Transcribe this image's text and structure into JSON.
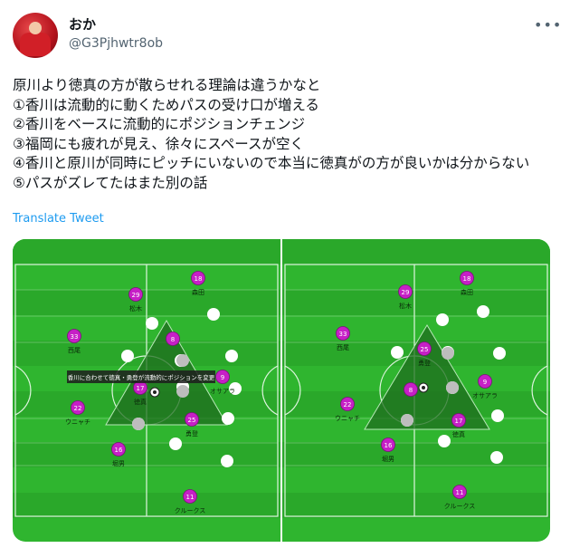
{
  "user": {
    "name": "おか",
    "handle": "@G3Pjhwtr8ob"
  },
  "icons": {
    "more": "more-horizontal-icon",
    "avatar": "profile-avatar"
  },
  "tweet": {
    "lines": [
      "原川より徳真の方が散らせれる理論は違うかなと",
      "①香川は流動的に動くためパスの受け口が増える",
      "②香川をベースに流動的にポジションチェンジ",
      "③福岡にも疲れが見え、徐々にスペースが空く",
      "④香川と原川が同時にピッチにいないので本当に徳真がの方が良いかは分からない",
      "⑤パスがズレてたはまた別の話"
    ],
    "translate": "Translate Tweet"
  },
  "left_pitch": {
    "annotation": "香川に合わせて徳真・勇登が流動的にポジションを変更",
    "players": [
      {
        "num": "18",
        "name": "森田"
      },
      {
        "num": "29",
        "name": "松木"
      },
      {
        "num": "33",
        "name": "西尾"
      },
      {
        "num": "8",
        "name": ""
      },
      {
        "num": "9",
        "name": "オサアラ"
      },
      {
        "num": "17",
        "name": "徳真"
      },
      {
        "num": "22",
        "name": "ウニャチ"
      },
      {
        "num": "25",
        "name": "勇登"
      },
      {
        "num": "16",
        "name": "堀男"
      },
      {
        "num": "11",
        "name": "クルークス"
      }
    ]
  },
  "right_pitch": {
    "players": [
      {
        "num": "18",
        "name": "森田"
      },
      {
        "num": "29",
        "name": "松木"
      },
      {
        "num": "33",
        "name": "西尾"
      },
      {
        "num": "25",
        "name": "勇登"
      },
      {
        "num": "9",
        "name": "オサアラ"
      },
      {
        "num": "8",
        "name": ""
      },
      {
        "num": "22",
        "name": "ウニャチ"
      },
      {
        "num": "17",
        "name": "徳真"
      },
      {
        "num": "16",
        "name": "堀男"
      },
      {
        "num": "11",
        "name": "クルークス"
      }
    ]
  },
  "colors": {
    "pitch": "#2fb52f",
    "pitch_stripe": "#2aa82a",
    "player": "#c61fc6",
    "opponent": "#ffffff",
    "triangle": "#1f6e1f",
    "link": "#1d9bf0"
  }
}
